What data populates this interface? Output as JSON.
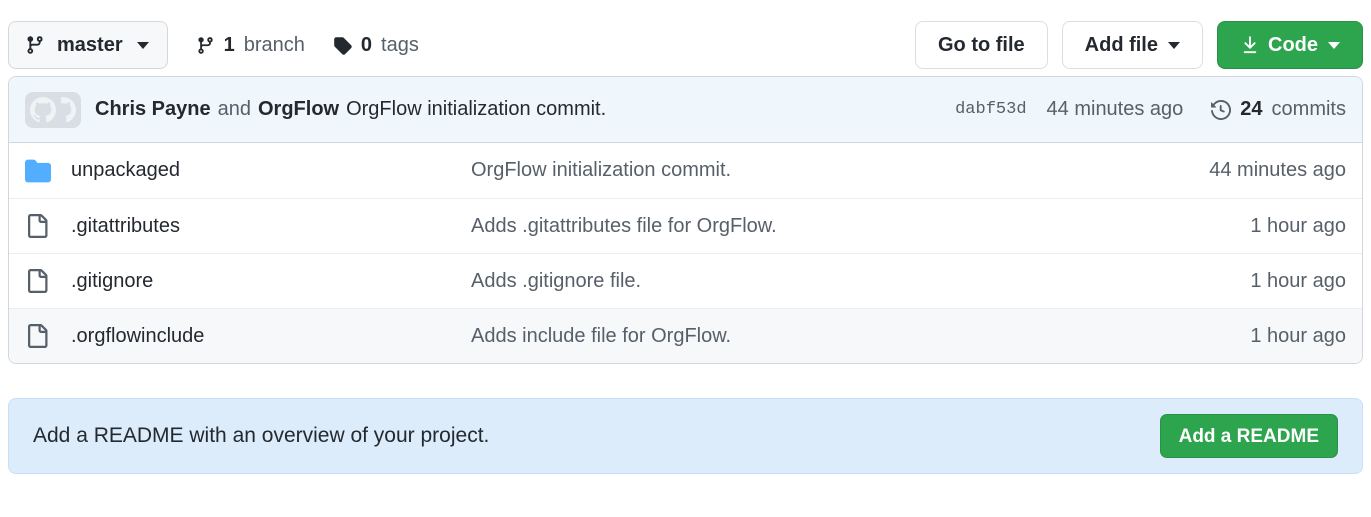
{
  "toolbar": {
    "branch_button": {
      "label": "master",
      "icon": "git-branch-icon",
      "caret": "chevron-down-icon"
    },
    "branch_count": {
      "value": "1",
      "label": "branch",
      "icon": "git-branch-icon"
    },
    "tag_count": {
      "value": "0",
      "label": "tags",
      "icon": "tag-icon"
    },
    "go_to_file": "Go to file",
    "add_file": "Add file",
    "code": "Code",
    "code_icon": "download-icon"
  },
  "commit_bar": {
    "author": "Chris Payne",
    "conjunction": "and",
    "coauthor": "OrgFlow",
    "message": "OrgFlow initialization commit.",
    "sha": "dabf53d",
    "relative_time": "44 minutes ago",
    "commits_count": "24",
    "commits_label": "commits",
    "history_icon": "history-icon",
    "avatar_icon": "octocat-avatar"
  },
  "files": [
    {
      "name": "unpackaged",
      "type": "directory",
      "icon": "folder-icon",
      "commit_message": "OrgFlow initialization commit.",
      "age": "44 minutes ago",
      "hovered": false
    },
    {
      "name": ".gitattributes",
      "type": "file",
      "icon": "file-icon",
      "commit_message": "Adds .gitattributes file for OrgFlow.",
      "age": "1 hour ago",
      "hovered": false
    },
    {
      "name": ".gitignore",
      "type": "file",
      "icon": "file-icon",
      "commit_message": "Adds .gitignore file.",
      "age": "1 hour ago",
      "hovered": false
    },
    {
      "name": ".orgflowinclude",
      "type": "file",
      "icon": "file-icon",
      "commit_message": "Adds include file for OrgFlow.",
      "age": "1 hour ago",
      "hovered": true
    }
  ],
  "readme_banner": {
    "text": "Add a README with an overview of your project.",
    "button_label": "Add a README"
  },
  "colors": {
    "green": "#2da44e",
    "folder_blue": "#54aeff",
    "commit_bar_blue": "#eff6fc",
    "banner_blue": "#dcecfb",
    "border": "#d0d7de",
    "muted_text": "#57606a",
    "text": "#24292f"
  }
}
